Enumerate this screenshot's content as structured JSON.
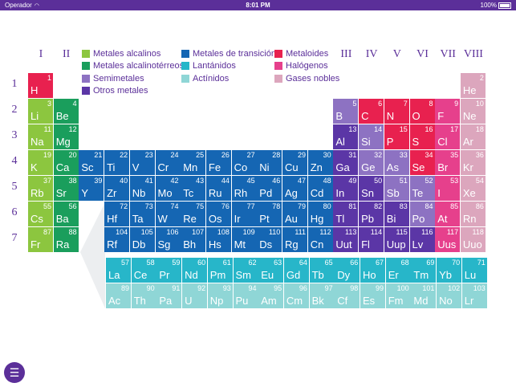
{
  "status_bar": {
    "carrier": "Operador",
    "time": "8:01 PM",
    "battery": "100%"
  },
  "colors": {
    "alkali": "#8cc63f",
    "alkaline": "#1a9e5c",
    "semimetal": "#8d72c2",
    "other_metal": "#5b36a6",
    "transition": "#1566b3",
    "lanthanide": "#27b6c9",
    "actinide": "#8fd6d6",
    "metalloid": "#e8214f",
    "halogen": "#e6408c",
    "noble": "#dca6bd",
    "accent": "#5b2f99"
  },
  "groups": [
    "I",
    "II",
    "III",
    "IV",
    "V",
    "VI",
    "VII",
    "VIII"
  ],
  "periods": [
    "1",
    "2",
    "3",
    "4",
    "5",
    "6",
    "7"
  ],
  "legend": [
    {
      "label": "Metales alcalinos",
      "color": "#8cc63f"
    },
    {
      "label": "Metales alcalinotérreos",
      "color": "#1a9e5c"
    },
    {
      "label": "Semimetales",
      "color": "#8d72c2"
    },
    {
      "label": "Otros metales",
      "color": "#5b36a6"
    },
    {
      "label": "Metales de transición",
      "color": "#1566b3"
    },
    {
      "label": "Lantánidos",
      "color": "#27b6c9"
    },
    {
      "label": "Actínidos",
      "color": "#8fd6d6"
    },
    {
      "label": "Metaloides",
      "color": "#e8214f"
    },
    {
      "label": "Halógenos",
      "color": "#e6408c"
    },
    {
      "label": "Gases nobles",
      "color": "#dca6bd"
    }
  ],
  "elements": [
    {
      "n": "1",
      "s": "H",
      "c": "metalloid"
    },
    {
      "n": "2",
      "s": "He",
      "c": "noble"
    },
    {
      "n": "3",
      "s": "Li",
      "c": "alkali"
    },
    {
      "n": "4",
      "s": "Be",
      "c": "alkaline"
    },
    {
      "n": "5",
      "s": "B",
      "c": "semimetal"
    },
    {
      "n": "6",
      "s": "C",
      "c": "metalloid"
    },
    {
      "n": "7",
      "s": "N",
      "c": "metalloid"
    },
    {
      "n": "8",
      "s": "O",
      "c": "metalloid"
    },
    {
      "n": "9",
      "s": "F",
      "c": "halogen"
    },
    {
      "n": "10",
      "s": "Ne",
      "c": "noble"
    },
    {
      "n": "11",
      "s": "Na",
      "c": "alkali"
    },
    {
      "n": "12",
      "s": "Mg",
      "c": "alkaline"
    },
    {
      "n": "13",
      "s": "Al",
      "c": "other_metal"
    },
    {
      "n": "14",
      "s": "Si",
      "c": "semimetal"
    },
    {
      "n": "15",
      "s": "P",
      "c": "metalloid"
    },
    {
      "n": "16",
      "s": "S",
      "c": "metalloid"
    },
    {
      "n": "17",
      "s": "Cl",
      "c": "halogen"
    },
    {
      "n": "18",
      "s": "Ar",
      "c": "noble"
    },
    {
      "n": "19",
      "s": "K",
      "c": "alkali"
    },
    {
      "n": "20",
      "s": "Ca",
      "c": "alkaline"
    },
    {
      "n": "21",
      "s": "Sc",
      "c": "transition"
    },
    {
      "n": "22",
      "s": "Ti",
      "c": "transition"
    },
    {
      "n": "23",
      "s": "V",
      "c": "transition"
    },
    {
      "n": "24",
      "s": "Cr",
      "c": "transition"
    },
    {
      "n": "25",
      "s": "Mn",
      "c": "transition"
    },
    {
      "n": "26",
      "s": "Fe",
      "c": "transition"
    },
    {
      "n": "27",
      "s": "Co",
      "c": "transition"
    },
    {
      "n": "28",
      "s": "Ni",
      "c": "transition"
    },
    {
      "n": "29",
      "s": "Cu",
      "c": "transition"
    },
    {
      "n": "30",
      "s": "Zn",
      "c": "transition"
    },
    {
      "n": "31",
      "s": "Ga",
      "c": "other_metal"
    },
    {
      "n": "32",
      "s": "Ge",
      "c": "semimetal"
    },
    {
      "n": "33",
      "s": "As",
      "c": "semimetal"
    },
    {
      "n": "34",
      "s": "Se",
      "c": "metalloid"
    },
    {
      "n": "35",
      "s": "Br",
      "c": "halogen"
    },
    {
      "n": "36",
      "s": "Kr",
      "c": "noble"
    },
    {
      "n": "37",
      "s": "Rb",
      "c": "alkali"
    },
    {
      "n": "38",
      "s": "Sr",
      "c": "alkaline"
    },
    {
      "n": "39",
      "s": "Y",
      "c": "transition"
    },
    {
      "n": "40",
      "s": "Zr",
      "c": "transition"
    },
    {
      "n": "41",
      "s": "Nb",
      "c": "transition"
    },
    {
      "n": "42",
      "s": "Mo",
      "c": "transition"
    },
    {
      "n": "43",
      "s": "Tc",
      "c": "transition"
    },
    {
      "n": "44",
      "s": "Ru",
      "c": "transition"
    },
    {
      "n": "45",
      "s": "Rh",
      "c": "transition"
    },
    {
      "n": "46",
      "s": "Pd",
      "c": "transition"
    },
    {
      "n": "47",
      "s": "Ag",
      "c": "transition"
    },
    {
      "n": "48",
      "s": "Cd",
      "c": "transition"
    },
    {
      "n": "49",
      "s": "In",
      "c": "other_metal"
    },
    {
      "n": "50",
      "s": "Sn",
      "c": "other_metal"
    },
    {
      "n": "51",
      "s": "Sb",
      "c": "semimetal"
    },
    {
      "n": "52",
      "s": "Te",
      "c": "semimetal"
    },
    {
      "n": "53",
      "s": "I",
      "c": "halogen"
    },
    {
      "n": "54",
      "s": "Xe",
      "c": "noble"
    },
    {
      "n": "55",
      "s": "Cs",
      "c": "alkali"
    },
    {
      "n": "56",
      "s": "Ba",
      "c": "alkaline"
    },
    {
      "n": "72",
      "s": "Hf",
      "c": "transition"
    },
    {
      "n": "73",
      "s": "Ta",
      "c": "transition"
    },
    {
      "n": "74",
      "s": "W",
      "c": "transition"
    },
    {
      "n": "75",
      "s": "Re",
      "c": "transition"
    },
    {
      "n": "76",
      "s": "Os",
      "c": "transition"
    },
    {
      "n": "77",
      "s": "Ir",
      "c": "transition"
    },
    {
      "n": "78",
      "s": "Pt",
      "c": "transition"
    },
    {
      "n": "79",
      "s": "Au",
      "c": "transition"
    },
    {
      "n": "80",
      "s": "Hg",
      "c": "transition"
    },
    {
      "n": "81",
      "s": "Tl",
      "c": "other_metal"
    },
    {
      "n": "82",
      "s": "Pb",
      "c": "other_metal"
    },
    {
      "n": "83",
      "s": "Bi",
      "c": "other_metal"
    },
    {
      "n": "84",
      "s": "Po",
      "c": "semimetal"
    },
    {
      "n": "85",
      "s": "At",
      "c": "halogen"
    },
    {
      "n": "86",
      "s": "Rn",
      "c": "noble"
    },
    {
      "n": "87",
      "s": "Fr",
      "c": "alkali"
    },
    {
      "n": "88",
      "s": "Ra",
      "c": "alkaline"
    },
    {
      "n": "104",
      "s": "Rf",
      "c": "transition"
    },
    {
      "n": "105",
      "s": "Db",
      "c": "transition"
    },
    {
      "n": "106",
      "s": "Sg",
      "c": "transition"
    },
    {
      "n": "107",
      "s": "Bh",
      "c": "transition"
    },
    {
      "n": "108",
      "s": "Hs",
      "c": "transition"
    },
    {
      "n": "109",
      "s": "Mt",
      "c": "transition"
    },
    {
      "n": "110",
      "s": "Ds",
      "c": "transition"
    },
    {
      "n": "111",
      "s": "Rg",
      "c": "transition"
    },
    {
      "n": "112",
      "s": "Cn",
      "c": "transition"
    },
    {
      "n": "113",
      "s": "Uut",
      "c": "other_metal"
    },
    {
      "n": "114",
      "s": "Fl",
      "c": "other_metal"
    },
    {
      "n": "115",
      "s": "Uup",
      "c": "other_metal"
    },
    {
      "n": "116",
      "s": "Lv",
      "c": "other_metal"
    },
    {
      "n": "117",
      "s": "Uus",
      "c": "halogen"
    },
    {
      "n": "118",
      "s": "Uuo",
      "c": "noble"
    },
    {
      "n": "57",
      "s": "La",
      "c": "lanthanide"
    },
    {
      "n": "58",
      "s": "Ce",
      "c": "lanthanide"
    },
    {
      "n": "59",
      "s": "Pr",
      "c": "lanthanide"
    },
    {
      "n": "60",
      "s": "Nd",
      "c": "lanthanide"
    },
    {
      "n": "61",
      "s": "Pm",
      "c": "lanthanide"
    },
    {
      "n": "62",
      "s": "Sm",
      "c": "lanthanide"
    },
    {
      "n": "63",
      "s": "Eu",
      "c": "lanthanide"
    },
    {
      "n": "64",
      "s": "Gd",
      "c": "lanthanide"
    },
    {
      "n": "65",
      "s": "Tb",
      "c": "lanthanide"
    },
    {
      "n": "66",
      "s": "Dy",
      "c": "lanthanide"
    },
    {
      "n": "67",
      "s": "Ho",
      "c": "lanthanide"
    },
    {
      "n": "68",
      "s": "Er",
      "c": "lanthanide"
    },
    {
      "n": "69",
      "s": "Tm",
      "c": "lanthanide"
    },
    {
      "n": "70",
      "s": "Yb",
      "c": "lanthanide"
    },
    {
      "n": "71",
      "s": "Lu",
      "c": "lanthanide"
    },
    {
      "n": "89",
      "s": "Ac",
      "c": "actinide"
    },
    {
      "n": "90",
      "s": "Th",
      "c": "actinide"
    },
    {
      "n": "91",
      "s": "Pa",
      "c": "actinide"
    },
    {
      "n": "92",
      "s": "U",
      "c": "actinide"
    },
    {
      "n": "93",
      "s": "Np",
      "c": "actinide"
    },
    {
      "n": "94",
      "s": "Pu",
      "c": "actinide"
    },
    {
      "n": "95",
      "s": "Am",
      "c": "actinide"
    },
    {
      "n": "96",
      "s": "Cm",
      "c": "actinide"
    },
    {
      "n": "97",
      "s": "Bk",
      "c": "actinide"
    },
    {
      "n": "98",
      "s": "Cf",
      "c": "actinide"
    },
    {
      "n": "99",
      "s": "Es",
      "c": "actinide"
    },
    {
      "n": "100",
      "s": "Fm",
      "c": "actinide"
    },
    {
      "n": "101",
      "s": "Md",
      "c": "actinide"
    },
    {
      "n": "102",
      "s": "No",
      "c": "actinide"
    },
    {
      "n": "103",
      "s": "Lr",
      "c": "actinide"
    }
  ]
}
